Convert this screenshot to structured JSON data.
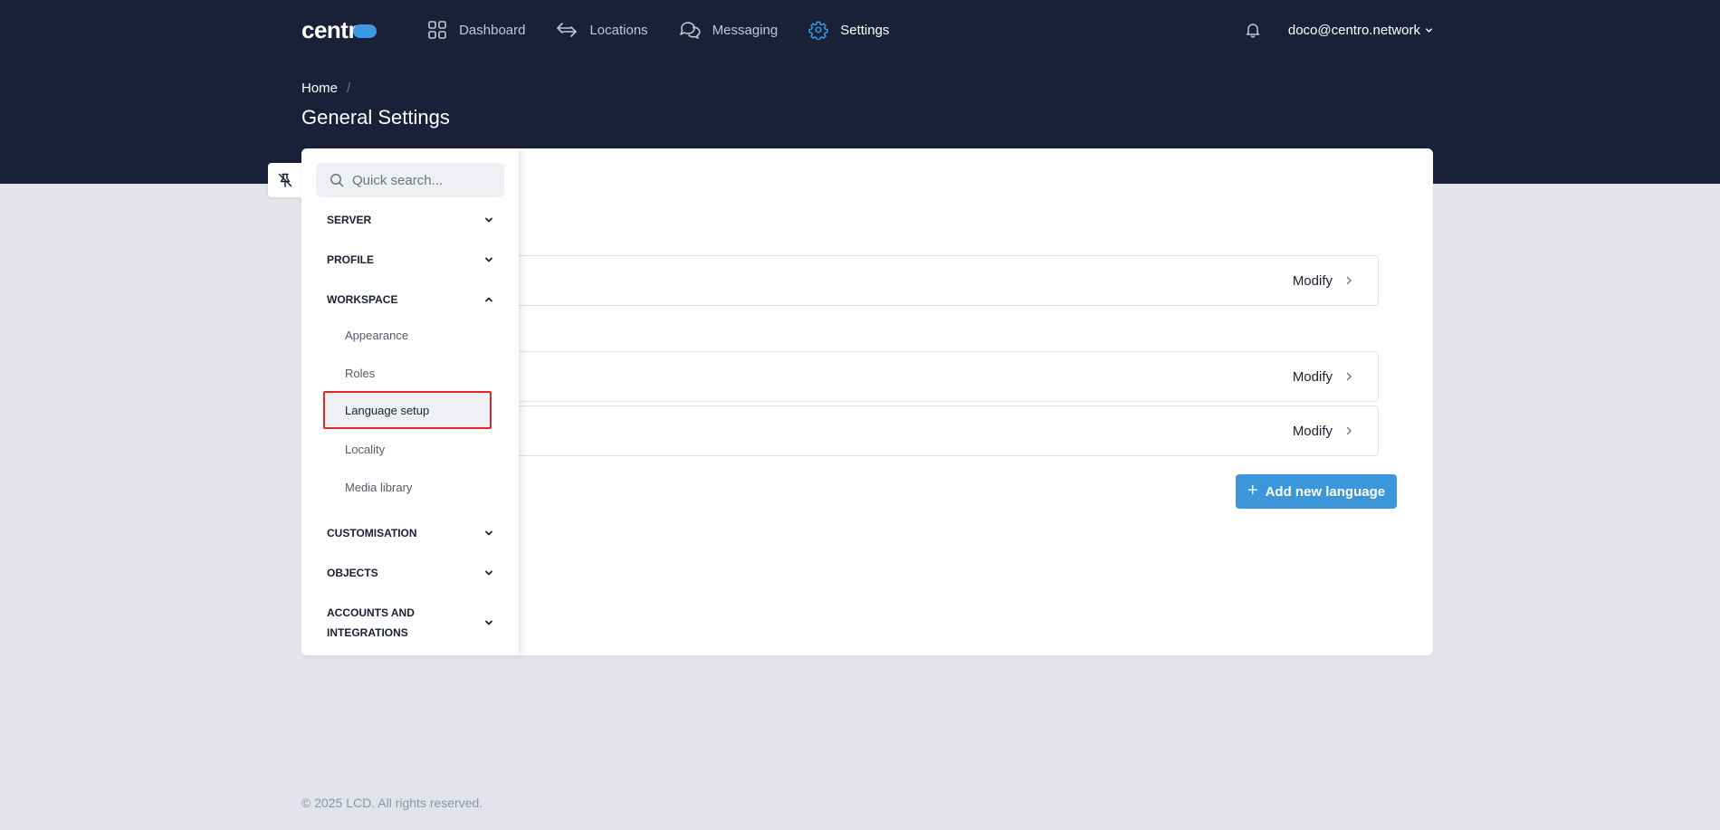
{
  "nav": {
    "logo": "centr",
    "items": [
      {
        "label": "Dashboard",
        "icon": "grid-icon"
      },
      {
        "label": "Locations",
        "icon": "arrows-swap-icon"
      },
      {
        "label": "Messaging",
        "icon": "chat-bubbles-icon"
      },
      {
        "label": "Settings",
        "icon": "gear-icon"
      }
    ],
    "active": "Settings",
    "user": "doco@centro.network"
  },
  "header": {
    "breadcrumb_home": "Home",
    "breadcrumb_sep": "/",
    "title": "General Settings"
  },
  "sidebar": {
    "search_placeholder": "Quick search...",
    "sections": {
      "server": "SERVER",
      "profile": "PROFILE",
      "workspace": "WORKSPACE",
      "customisation": "CUSTOMISATION",
      "objects": "OBJECTS",
      "accounts": "ACCOUNTS AND INTEGRATIONS"
    },
    "workspace_items": [
      "Appearance",
      "Roles",
      "Language setup",
      "Locality",
      "Media library"
    ],
    "selected": "Language setup"
  },
  "main": {
    "modify_label": "Modify",
    "add_button": "Add new language",
    "add_button_plus": "+"
  },
  "footer": "© 2025 LCD. All rights reserved.",
  "colors": {
    "header_bg": "#1b2039",
    "accent": "#3b97d9",
    "page_bg": "#e2e4e9",
    "selection_outline": "#e3262c"
  }
}
